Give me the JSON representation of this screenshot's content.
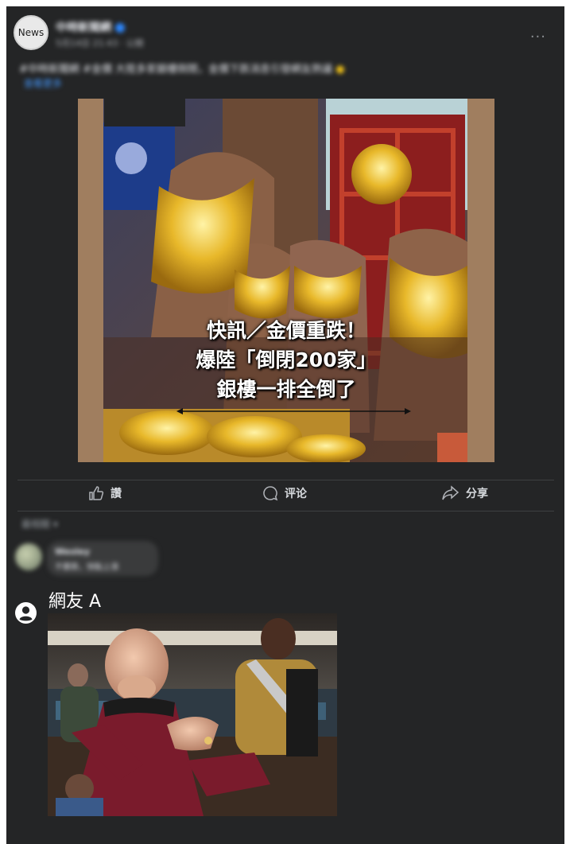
{
  "post": {
    "avatar_label": "News",
    "page_name": "中時新聞網",
    "timestamp": "5月14日 21:43 · 公開",
    "body_text": "#中時新聞網 #金價 大陸多家銀樓倒閉，金價下跌消息引發網友熱議",
    "body_link": "查看更多",
    "more_label": "···"
  },
  "image": {
    "caption_lines": [
      "快訊／金價重跌！",
      "爆陸「倒閉200家」",
      "銀樓一排全倒了"
    ]
  },
  "actions": {
    "like": "讚",
    "comment": "评论",
    "share": "分享"
  },
  "comments": {
    "sort_label": "最相關 ▾",
    "blurred_name": "Wesley",
    "blurred_text": "不要跌，快點上漲",
    "reply_author": "網友 A"
  },
  "colors": {
    "panel": "#242526",
    "text_muted": "#b0b3b8",
    "gold": "#e6b422",
    "uniform_red": "#7a1b2c"
  }
}
